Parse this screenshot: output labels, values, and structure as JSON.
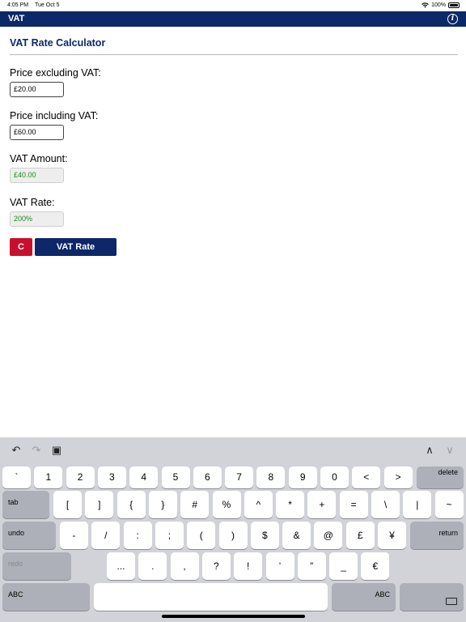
{
  "status": {
    "time": "4:05 PM",
    "date": "Tue Oct 5",
    "battery": "100%"
  },
  "nav": {
    "title": "VAT"
  },
  "page": {
    "title": "VAT Rate Calculator",
    "fields": {
      "price_ex_label": "Price excluding VAT:",
      "price_ex_value": "£20.00",
      "price_inc_label": "Price including VAT:",
      "price_inc_value": "£60.00",
      "vat_amount_label": "VAT Amount:",
      "vat_amount_value": "£40.00",
      "vat_rate_label": "VAT Rate:",
      "vat_rate_value": "200%"
    },
    "buttons": {
      "clear": "C",
      "calculate": "VAT Rate"
    }
  },
  "keyboard": {
    "toolbar": {
      "undo": "↶",
      "redo": "↷",
      "paste": "▣",
      "up": "∧",
      "down": "∨"
    },
    "row1": [
      "`",
      "1",
      "2",
      "3",
      "4",
      "5",
      "6",
      "7",
      "8",
      "9",
      "0",
      "<",
      ">"
    ],
    "row1_delete": "delete",
    "row2_tab": "tab",
    "row2": [
      "[",
      "]",
      "{",
      "}",
      "#",
      "%",
      "^",
      "*",
      "+",
      "=",
      "\\",
      "|",
      "~"
    ],
    "row3_undo": "undo",
    "row3": [
      "-",
      "/",
      ":",
      ";",
      "(",
      ")",
      "$",
      "&",
      "@",
      "£",
      "¥"
    ],
    "row3_return": "return",
    "row4_redo": "redo",
    "row4": [
      "...",
      ".",
      ",",
      "?",
      "!",
      "’",
      "”",
      "_",
      "€"
    ],
    "row5_abc_left": "ABC",
    "row5_abc_right": "ABC"
  }
}
